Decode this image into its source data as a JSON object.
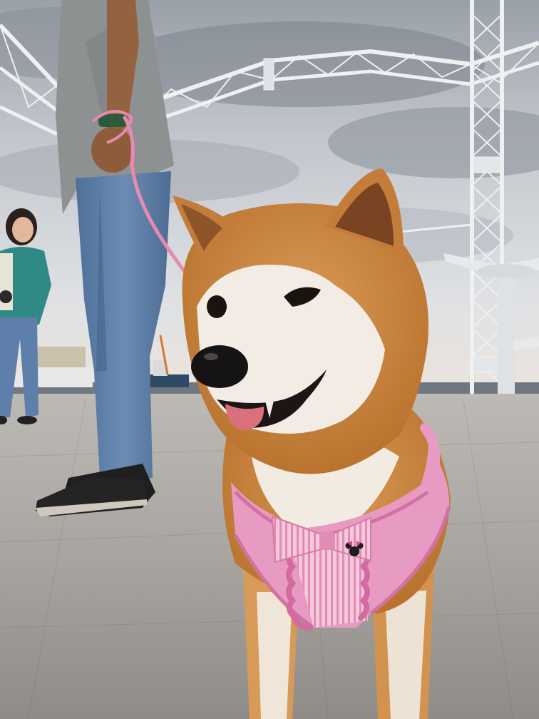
{
  "photo": {
    "subject": "dog",
    "scene_elements": [
      "cloudy-sky",
      "steel-truss-arch",
      "lattice-tower",
      "sea-horizon",
      "harbor-ship",
      "concrete-pier",
      "person-holding-leash",
      "person-in-background",
      "shiba-inu-dog",
      "pink-harness",
      "bow-tie",
      "mouse-emblem"
    ]
  },
  "palette": {
    "sky_light": "#e4e6ea",
    "sky_dark": "#8d929b",
    "ground": "#a9a6a1",
    "dog_fur": "#c9833f",
    "dog_cream": "#f1ebe2",
    "harness_pink": "#e79ac2",
    "leash_pink": "#e88ab0",
    "jeans_blue": "#5f7fa6",
    "shirt_gray": "#8d9191",
    "truss_white": "#eef0f2"
  }
}
